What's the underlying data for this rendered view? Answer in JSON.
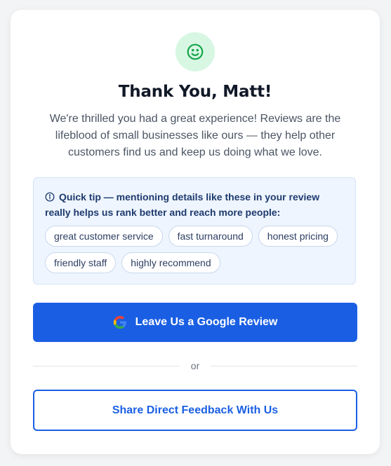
{
  "thanks": {
    "title": "Thank You, Matt!",
    "message": "We're thrilled you had a great experience! Reviews are the lifeblood of small businesses like ours — they help other customers find us and keep us doing what we love."
  },
  "tip": {
    "text": "Quick tip — mentioning details like these in your review really helps us rank better and reach more people:",
    "chips": [
      "great customer service",
      "fast turnaround",
      "honest pricing",
      "friendly staff",
      "highly recommend"
    ]
  },
  "actions": {
    "google_review_label": "Leave Us a Google Review",
    "divider_label": "or",
    "feedback_label": "Share Direct Feedback With Us"
  },
  "colors": {
    "primary": "#1a5fe3",
    "success_bg": "#d7f7e3",
    "success": "#16a34a",
    "tip_bg": "#eef5fe"
  },
  "icons": {
    "header": "smile-icon",
    "tip": "info-icon",
    "google": "google-g-icon"
  }
}
